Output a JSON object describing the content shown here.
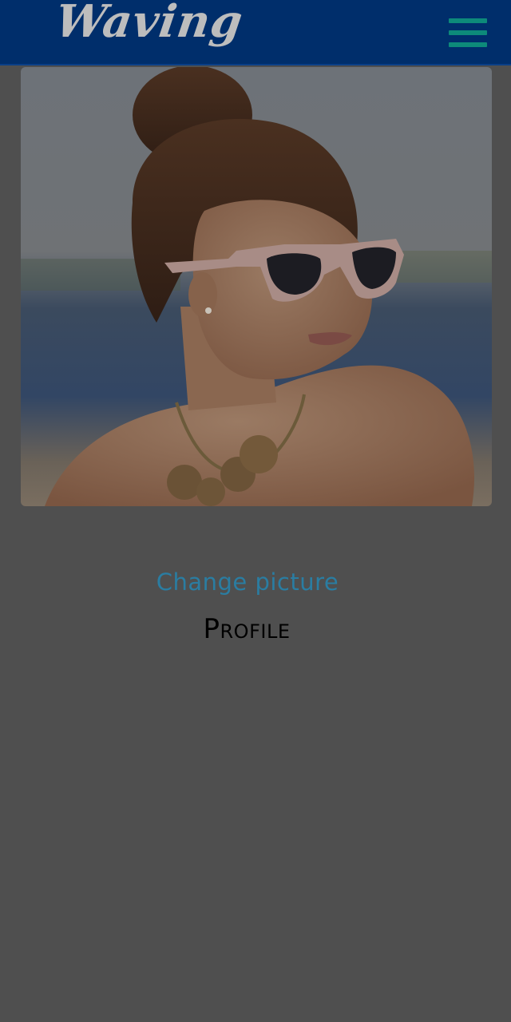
{
  "header": {
    "logo_text": "Waving",
    "menu_icon": "hamburger-menu-icon",
    "background_color": "#002e6b",
    "menu_color": "#0d8a7a"
  },
  "profile": {
    "change_picture_label": "Change picture",
    "title": "Profile"
  },
  "colors": {
    "page_background": "#4f4f4f",
    "link": "#2a7da2"
  }
}
